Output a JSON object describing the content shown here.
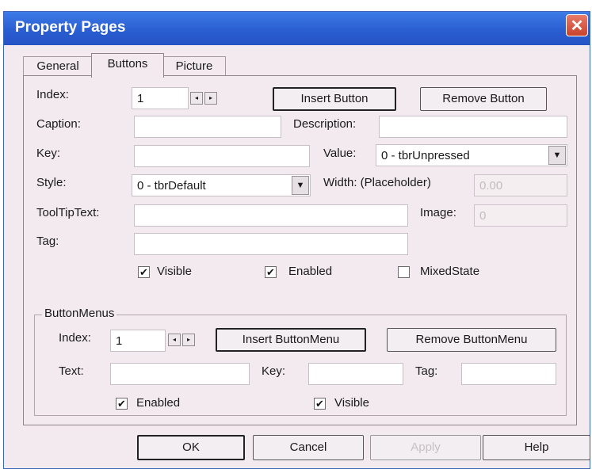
{
  "window": {
    "title": "Property Pages"
  },
  "tabs": [
    "General",
    "Buttons",
    "Picture"
  ],
  "buttons_tab": {
    "index": {
      "label": "Index:",
      "value": "1"
    },
    "insert_button": "Insert Button",
    "remove_button": "Remove Button",
    "caption": {
      "label": "Caption:",
      "value": ""
    },
    "description": {
      "label": "Description:",
      "value": ""
    },
    "key": {
      "label": "Key:",
      "value": ""
    },
    "value": {
      "label": "Value:",
      "selected": "0 - tbrUnpressed"
    },
    "style": {
      "label": "Style:",
      "selected": "0 - tbrDefault"
    },
    "width": {
      "label": "Width: (Placeholder)",
      "value": "0.00"
    },
    "tooltip": {
      "label": "ToolTipText:",
      "value": ""
    },
    "image": {
      "label": "Image:",
      "value": "0"
    },
    "tag": {
      "label": "Tag:",
      "value": ""
    },
    "visible": {
      "label": "Visible",
      "checked": true
    },
    "enabled": {
      "label": "Enabled",
      "checked": true
    },
    "mixedstate": {
      "label": "MixedState",
      "checked": false
    }
  },
  "button_menus": {
    "title": "ButtonMenus",
    "index": {
      "label": "Index:",
      "value": "1"
    },
    "insert_menu": "Insert ButtonMenu",
    "remove_menu": "Remove ButtonMenu",
    "text": {
      "label": "Text:",
      "value": ""
    },
    "key": {
      "label": "Key:",
      "value": ""
    },
    "tag": {
      "label": "Tag:",
      "value": ""
    },
    "enabled": {
      "label": "Enabled",
      "checked": true
    },
    "visible": {
      "label": "Visible",
      "checked": true
    }
  },
  "footer": {
    "ok": "OK",
    "cancel": "Cancel",
    "apply": "Apply",
    "help": "Help"
  },
  "icons": {
    "close": "close-icon",
    "spin_up": "spin-up-icon",
    "spin_down": "spin-down-icon",
    "dropdown": "chevron-down-icon",
    "check": "checkmark-icon"
  },
  "colors": {
    "titlebar": "#2a5ed2",
    "close": "#c9432c",
    "dialog_bg": "#f2eaee"
  }
}
